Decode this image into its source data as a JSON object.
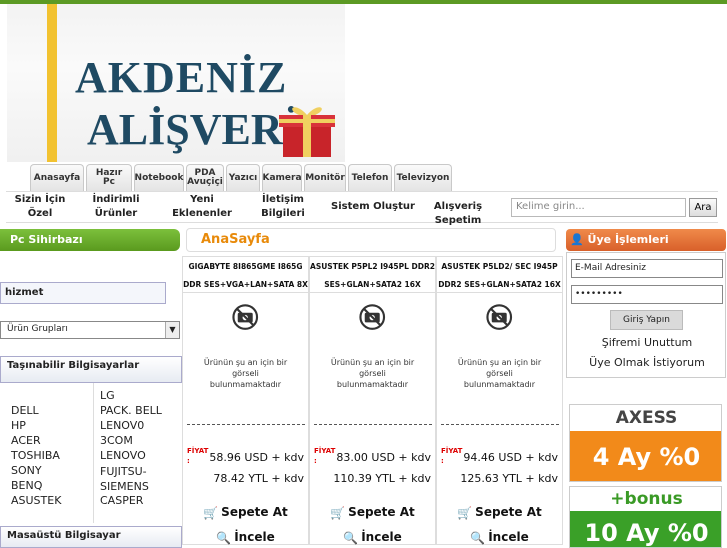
{
  "logo": {
    "line1": "AKDENİZ",
    "line2": "ALİŞVERİŞ"
  },
  "tabs": [
    {
      "label": "Anasayfa"
    },
    {
      "label": "Hazır Pc"
    },
    {
      "label": "Notebook"
    },
    {
      "label": "PDA Avuçiçi"
    },
    {
      "label": "Yazıcı"
    },
    {
      "label": "Kamera"
    },
    {
      "label": "Monitör"
    },
    {
      "label": "Telefon"
    },
    {
      "label": "Televizyon"
    }
  ],
  "nav2": {
    "items": [
      "Sizin İçin Özel",
      "İndirimli Ürünler",
      "Yeni Eklenenler",
      "İletişim Bilgileri",
      "Sistem Oluştur",
      "Alışveriş Sepetim"
    ],
    "search_placeholder": "Kelime girin...",
    "search_button": "Ara"
  },
  "left": {
    "pc_header": "Pc Sihirbazı",
    "hizmet": "hizmet",
    "urun_select": "Ürün Grupları",
    "cat1": "Taşınabilir Bilgisayarlar",
    "brands_left": [
      "DELL",
      "HP",
      "ACER",
      "TOSHIBA",
      "SONY",
      "BENQ",
      "ASUSTEK"
    ],
    "brands_right": [
      "LG",
      "PACK. BELL",
      "LENOV0",
      "3COM",
      "LENOVO",
      "FUJITSU-SIEMENS",
      "CASPER"
    ],
    "cat2": "Masaüstü Bilgisayar"
  },
  "center": {
    "title": "AnaSayfa",
    "products": [
      {
        "name": "GIGABYTE 8I865GME I865G DDR SES+VGA+LAN+SATA 8X",
        "no_image": "Ürünün şu an için bir görseli bulunmamaktadır",
        "fiyat_label": "FİYAT :",
        "usd": "58.96 USD + kdv",
        "ytl": "78.42 YTL + kdv",
        "cart": "Sepete At",
        "detail": "İncele"
      },
      {
        "name": "ASUSTEK P5PL2 I945PL DDR2 SES+GLAN+SATA2 16X",
        "no_image": "Ürünün şu an için bir görseli bulunmamaktadır",
        "fiyat_label": "FİYAT :",
        "usd": "83.00 USD + kdv",
        "ytl": "110.39 YTL + kdv",
        "cart": "Sepete At",
        "detail": "İncele"
      },
      {
        "name": "ASUSTEK P5LD2/ SEC I945P DDR2 SES+GLAN+SATA2 16X",
        "no_image": "Ürünün şu an için bir görseli bulunmamaktadır",
        "fiyat_label": "FİYAT :",
        "usd": "94.46 USD + kdv",
        "ytl": "125.63 YTL + kdv",
        "cart": "Sepete At",
        "detail": "İncele"
      }
    ]
  },
  "right": {
    "header": "Üye İşlemleri",
    "email_value": "E-Mail Adresiniz",
    "password_value": "•••••••••",
    "login_button": "Giriş Yapın",
    "forgot": "Şifremi Unuttum",
    "register": "Üye Olmak İstiyorum",
    "axess_brand": "AXESS",
    "axess_offer": "4 Ay %0",
    "bonus_brand": "+bonus",
    "bonus_offer": "10 Ay %0"
  }
}
